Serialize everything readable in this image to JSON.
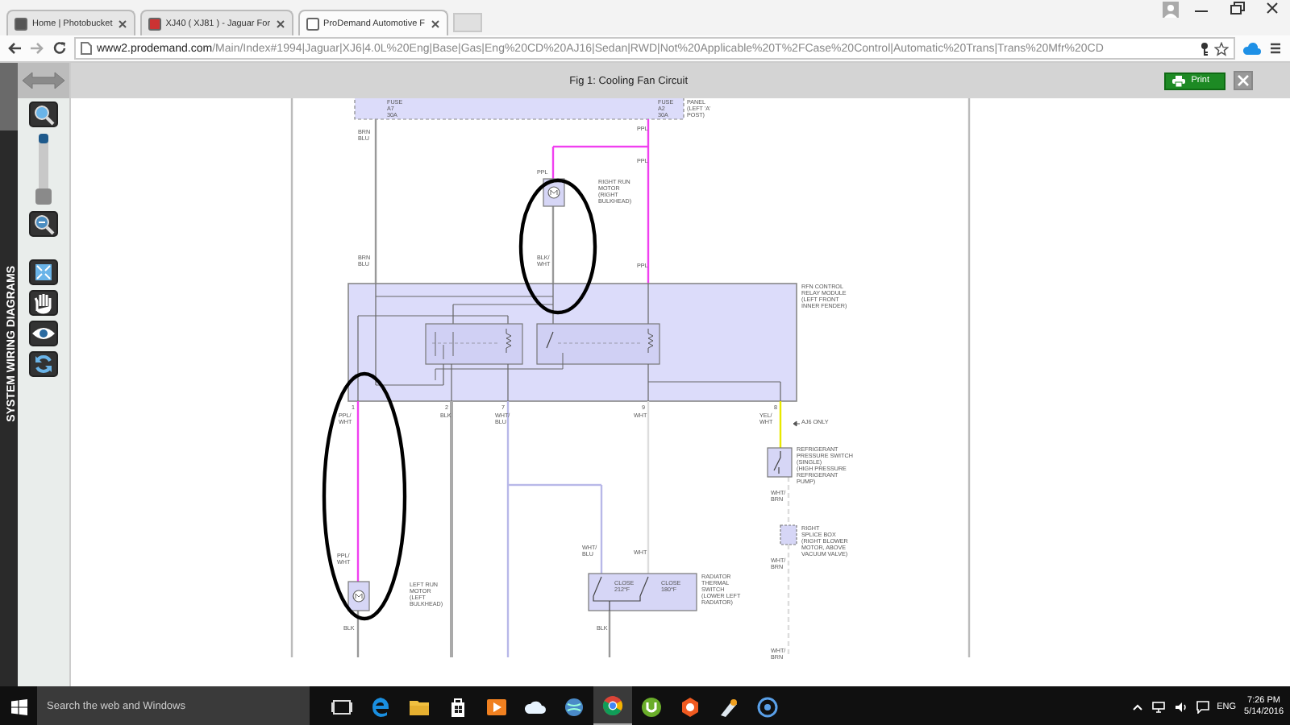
{
  "browser": {
    "tabs": [
      {
        "label": "Home | Photobucket",
        "selected": false
      },
      {
        "label": "XJ40 ( XJ81 ) - Jaguar For",
        "selected": false
      },
      {
        "label": "ProDemand Automotive F",
        "selected": true
      }
    ],
    "url": {
      "host": "www2.prodemand.com",
      "path": "/Main/Index#1994|Jaguar|XJ6|4.0L%20Eng|Base|Gas|Eng%20CD%20AJ16|Sedan|RWD|Not%20Applicable%20T%2FCase%20Control|Automatic%20Trans|Trans%20Mfr%20CD"
    }
  },
  "app": {
    "sidebar_title": "SYSTEM WIRING DIAGRAMS",
    "zoom": {
      "level": 0
    },
    "title": "Fig 1: Cooling Fan Circuit",
    "print_button": "Print"
  },
  "diagram": {
    "labels": [
      {
        "lines": [
          "FUSE",
          "A7",
          "30A"
        ]
      },
      {
        "lines": [
          "FUSE",
          "A2",
          "30A"
        ]
      },
      {
        "lines": [
          "PANEL",
          "(LEFT 'A'",
          "POST)"
        ]
      },
      {
        "lines": [
          "BRN",
          "BLU"
        ]
      },
      {
        "lines": [
          "PPL"
        ]
      },
      {
        "lines": [
          "PPL"
        ]
      },
      {
        "lines": [
          "PPL"
        ]
      },
      {
        "lines": [
          "RIGHT RUN",
          "MOTOR",
          "(RIGHT",
          "BULKHEAD)"
        ]
      },
      {
        "lines": [
          "BRN",
          "BLU"
        ]
      },
      {
        "lines": [
          "BLK/",
          "WHT"
        ]
      },
      {
        "lines": [
          "PPL"
        ]
      },
      {
        "lines": [
          "RFN CONTROL",
          "RELAY MODULE",
          "(LEFT FRONT",
          "INNER FENDER)"
        ]
      },
      {
        "lines": [
          "1"
        ]
      },
      {
        "lines": [
          "2"
        ]
      },
      {
        "lines": [
          "7"
        ]
      },
      {
        "lines": [
          "9"
        ]
      },
      {
        "lines": [
          "8"
        ]
      },
      {
        "lines": [
          "PPL/",
          "WHT"
        ]
      },
      {
        "lines": [
          "BLK"
        ]
      },
      {
        "lines": [
          "WHT/",
          "BLU"
        ]
      },
      {
        "lines": [
          "WHT"
        ]
      },
      {
        "lines": [
          "YEL/",
          "WHT"
        ]
      },
      {
        "lines": [
          "AJ6 ONLY"
        ]
      },
      {
        "lines": [
          "REFRIGERANT",
          "PRESSURE SWITCH",
          "(SINGLE)",
          "(HIGH PRESSURE",
          "REFRIGERANT",
          "PUMP)"
        ]
      },
      {
        "lines": [
          "WHT/",
          "BRN"
        ]
      },
      {
        "lines": [
          "RIGHT",
          "SPLICE BOX",
          "(RIGHT BLOWER",
          "MOTOR, ABOVE",
          "VACUUM VALVE)"
        ]
      },
      {
        "lines": [
          "WHT/",
          "BRN"
        ]
      },
      {
        "lines": [
          "PPL/",
          "WHT"
        ]
      },
      {
        "lines": [
          "LEFT RUN",
          "MOTOR",
          "(LEFT",
          "BULKHEAD)"
        ]
      },
      {
        "lines": [
          "WHT/",
          "BLU"
        ]
      },
      {
        "lines": [
          "WHT"
        ]
      },
      {
        "lines": [
          "CLOSE",
          "212°F"
        ]
      },
      {
        "lines": [
          "CLOSE",
          "180°F"
        ]
      },
      {
        "lines": [
          "RADIATOR",
          "THERMAL",
          "SWITCH",
          "(LOWER LEFT",
          "RADIATOR)"
        ]
      },
      {
        "lines": [
          "BLK"
        ]
      },
      {
        "lines": [
          "BLK"
        ]
      },
      {
        "lines": [
          "WHT/",
          "BRN"
        ]
      }
    ]
  },
  "taskbar": {
    "search_placeholder": "Search the web and Windows",
    "language": "ENG",
    "time": "7:26 PM",
    "date": "5/14/2016"
  }
}
